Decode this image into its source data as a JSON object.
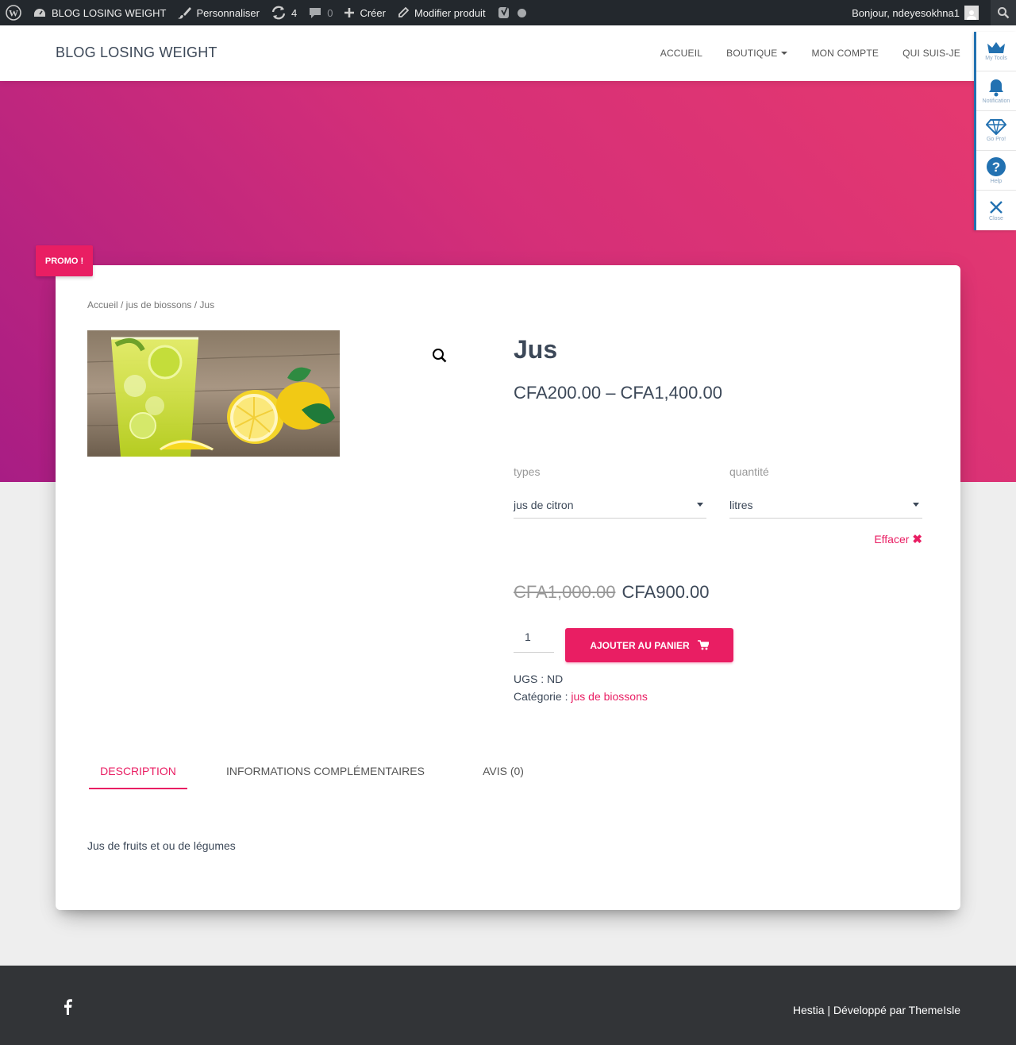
{
  "adminbar": {
    "site_name": "BLOG LOSING WEIGHT",
    "customize": "Personnaliser",
    "updates_count": "4",
    "comments_count": "0",
    "new": "Créer",
    "edit": "Modifier produit",
    "greeting": "Bonjour, ndeyesokhna1"
  },
  "header": {
    "brand": "BLOG LOSING WEIGHT",
    "nav": {
      "home": "ACCUEIL",
      "shop": "BOUTIQUE",
      "account": "MON COMPTE",
      "about": "QUI SUIS-JE"
    }
  },
  "tools": {
    "my_tools": "My Tools",
    "notification": "Notification",
    "go_pro": "Go Pro!",
    "help": "Help",
    "close": "Close"
  },
  "promo": "PROMO !",
  "product": {
    "breadcrumb": "Accueil / jus de biossons / Jus",
    "title": "Jus",
    "price_range": "CFA200.00 – CFA1,400.00",
    "attributes": {
      "types_label": "types",
      "types_value": "jus de citron",
      "qty_label": "quantité",
      "qty_value": "litres"
    },
    "clear": "Effacer",
    "old_price": "CFA1,000.00",
    "sale_price": "CFA900.00",
    "quantity": "1",
    "add_to_cart": "AJOUTER AU PANIER",
    "sku_label": "UGS :",
    "sku_value": "ND",
    "category_label": "Catégorie :",
    "category_value": "jus de biossons"
  },
  "tabs": {
    "description": "DESCRIPTION",
    "additional": "INFORMATIONS COMPLÉMENTAIRES",
    "reviews": "AVIS (0)"
  },
  "description_text": "Jus de fruits et ou de légumes",
  "footer": {
    "credit_theme": "Hestia | Développé par",
    "credit_author": "ThemeIsle"
  },
  "colors": {
    "accent": "#e91e63",
    "adminbar": "#23282d",
    "footer": "#323437"
  }
}
